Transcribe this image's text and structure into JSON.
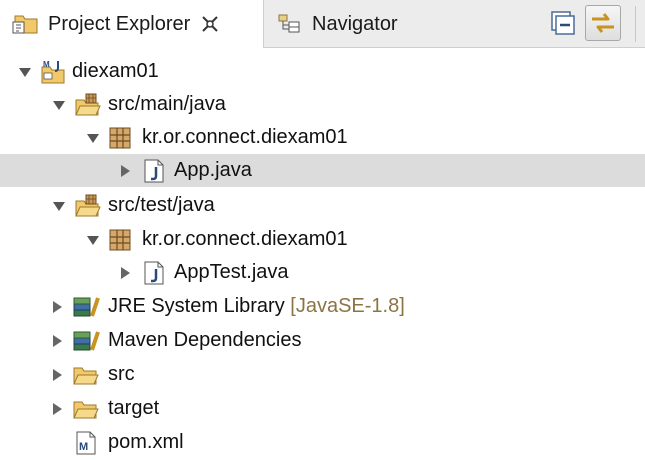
{
  "tabs": [
    {
      "label": "Project Explorer",
      "active": true,
      "icon": "project-explorer-icon"
    },
    {
      "label": "Navigator",
      "active": false,
      "icon": "navigator-icon"
    }
  ],
  "toolbar": {
    "collapse_icon": "collapse-all-icon",
    "link_icon": "link-with-editor-icon"
  },
  "tree": {
    "project": {
      "label": "diexam01",
      "expanded": true
    },
    "src_main": {
      "label": "src/main/java",
      "expanded": true
    },
    "pkg_main": {
      "label": "kr.or.connect.diexam01",
      "expanded": true
    },
    "app_java": {
      "label": "App.java",
      "expanded": false,
      "selected": true
    },
    "src_test": {
      "label": "src/test/java",
      "expanded": true
    },
    "pkg_test": {
      "label": "kr.or.connect.diexam01",
      "expanded": true
    },
    "apptest_java": {
      "label": "AppTest.java",
      "expanded": false
    },
    "jre": {
      "label": "JRE System Library",
      "decoration": "[JavaSE-1.8]",
      "expanded": false
    },
    "maven": {
      "label": "Maven Dependencies",
      "expanded": false
    },
    "src": {
      "label": "src",
      "expanded": false
    },
    "target": {
      "label": "target",
      "expanded": false
    },
    "pom": {
      "label": "pom.xml"
    }
  },
  "colors": {
    "selection": "#dcdcdc",
    "decoration": "#8a7443",
    "folder": "#e2b552"
  }
}
